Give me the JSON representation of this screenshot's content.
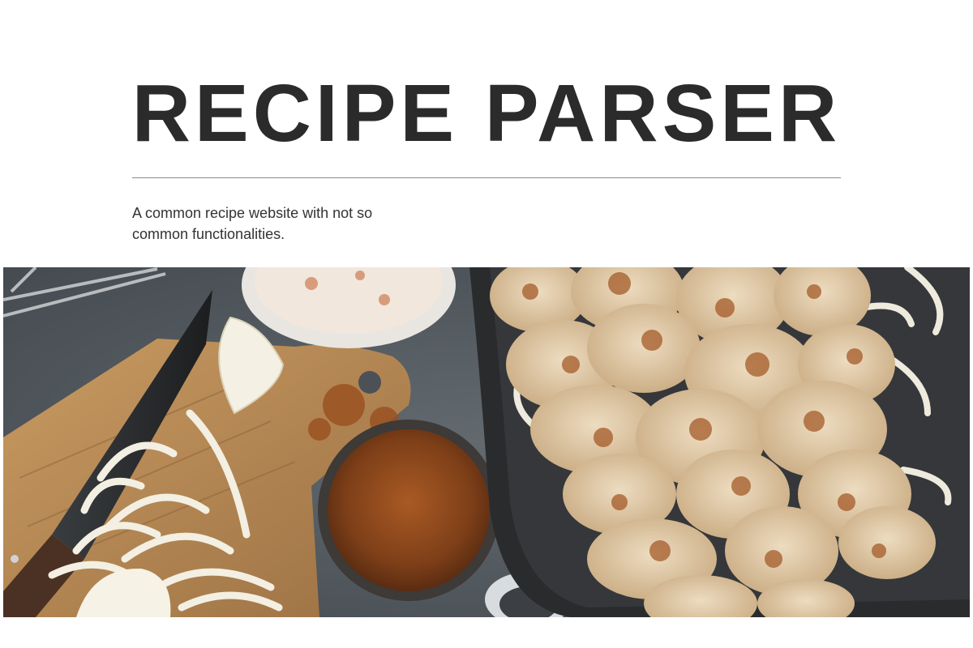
{
  "header": {
    "title": "RECIPE PARSER",
    "tagline": "A common recipe website with not so common functionalities."
  },
  "hero": {
    "image_description_icon": "food-photo",
    "colors": {
      "countertop": "#545b60",
      "board": "#b98c55",
      "spice": "#8a4a1e",
      "meat": "#e3cfb0",
      "tray": "#2a2b2d"
    }
  },
  "theme": {
    "title_color": "#2b2b2b",
    "text_color": "#333333",
    "divider_color": "#8a8a8a",
    "background": "#ffffff"
  }
}
